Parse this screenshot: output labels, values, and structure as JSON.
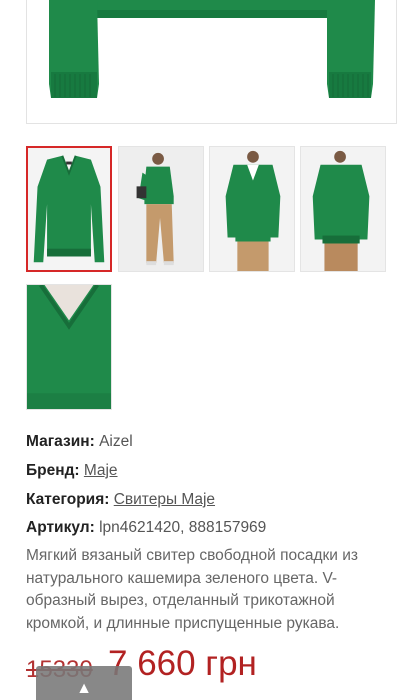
{
  "product": {
    "colors": {
      "sweater": "#1f8a4a",
      "sweater_dark": "#176e3a",
      "pants": "#b98a5e",
      "active_border": "#d62828",
      "price": "#b22222"
    },
    "gallery": {
      "main_image": "green-sweater-image",
      "thumbnails": [
        {
          "name": "thumb-flat-front",
          "active": true
        },
        {
          "name": "thumb-model-side"
        },
        {
          "name": "thumb-model-front"
        },
        {
          "name": "thumb-model-back"
        },
        {
          "name": "thumb-neckline-detail"
        }
      ]
    },
    "shop": {
      "label": "Магазин:",
      "value": "Aizel"
    },
    "brand": {
      "label": "Бренд:",
      "value": "Maje"
    },
    "category": {
      "label": "Категория:",
      "value": "Свитеры Maje"
    },
    "sku": {
      "label": "Артикул:",
      "value": "lpn4621420, 888157969"
    },
    "description": "Мягкий вязаный свитер свободной посадки из натурального кашемира зеленого цвета. V-образный вырез, отделанный трикотажной кромкой, и длинные приспущенные рукава.",
    "price": {
      "old": "15330",
      "new": "7 660 грн"
    },
    "scroll_top_icon": "▲"
  }
}
